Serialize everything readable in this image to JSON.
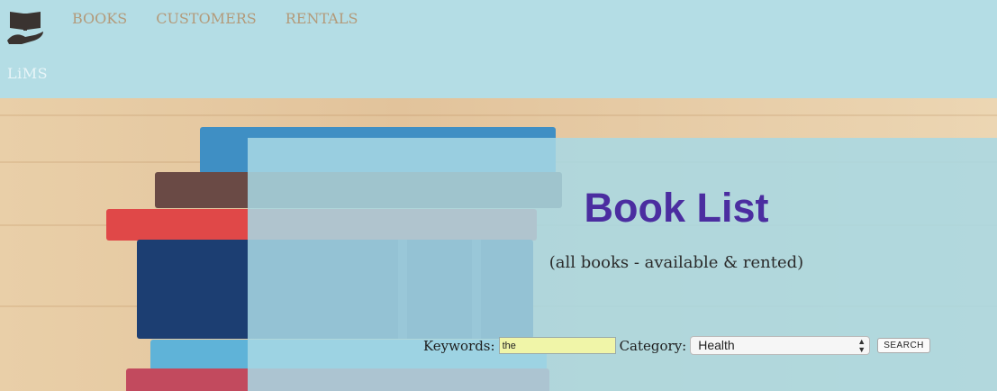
{
  "header": {
    "brand": "LiMS",
    "logo_icon": "book-in-hand-icon",
    "nav": [
      {
        "label": "BOOKS"
      },
      {
        "label": "CUSTOMERS"
      },
      {
        "label": "RENTALS"
      }
    ]
  },
  "main": {
    "title": "Book List",
    "subtitle": "(all books - available & rented)"
  },
  "search": {
    "keywords_label": "Keywords:",
    "keywords_value": "the",
    "category_label": "Category:",
    "category_value": "Health",
    "button_label": "SEARCH"
  },
  "colors": {
    "header_bg": "#b4dde5",
    "nav_text": "#b39a7a",
    "title": "#4b2da0",
    "keyword_field_bg": "#f0f5a8"
  }
}
